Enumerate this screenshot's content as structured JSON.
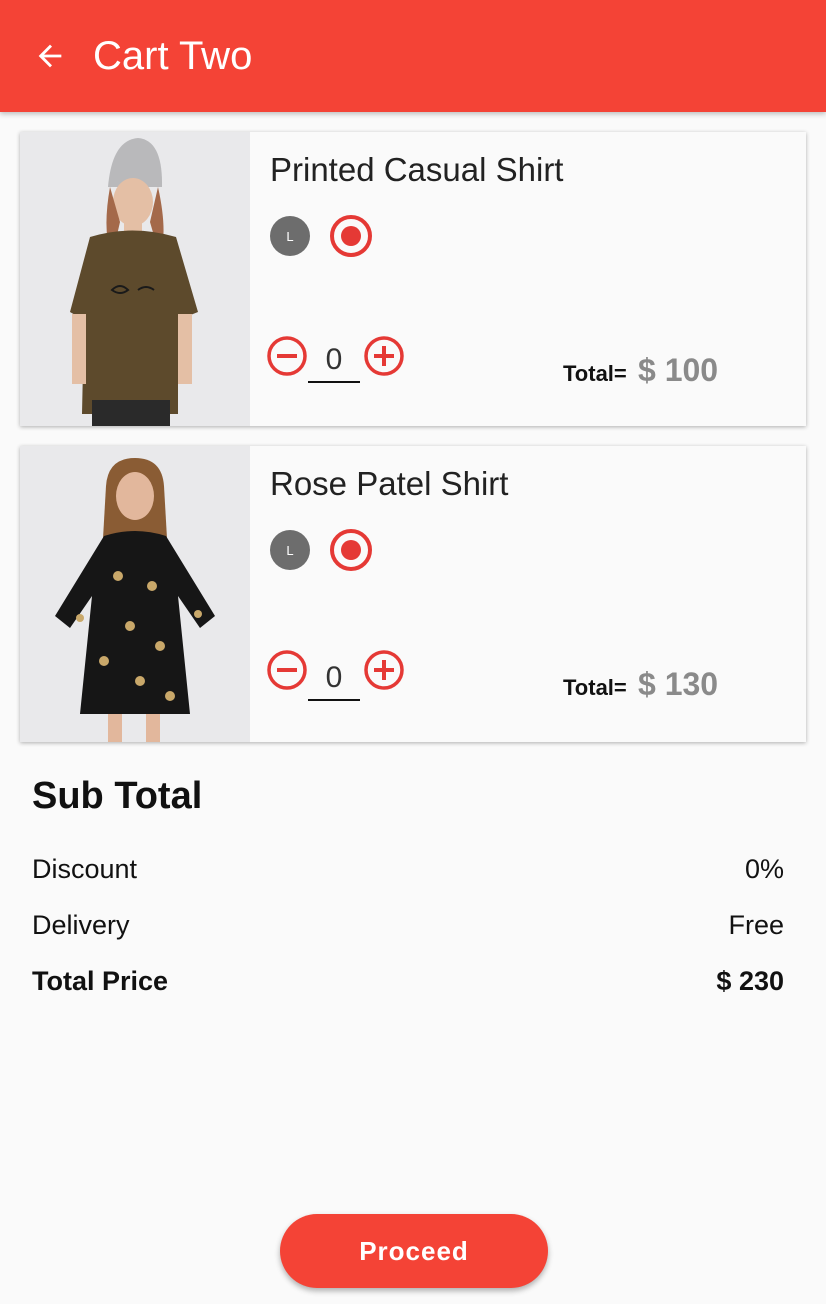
{
  "appbar": {
    "title": "Cart Two",
    "back_icon": "arrow-back-icon",
    "color": "#f44336"
  },
  "cart": {
    "items": [
      {
        "name": "Printed Casual Shirt",
        "size": "L",
        "quantity": "0",
        "total_label": "Total=",
        "total": "$ 100"
      },
      {
        "name": "Rose Patel Shirt",
        "size": "L",
        "quantity": "0",
        "total_label": "Total=",
        "total": "$ 130"
      }
    ],
    "icons": {
      "minus": "remove-circle-outline-icon",
      "plus": "add-circle-outline-icon",
      "radio": "radio-button-checked-icon"
    },
    "accent": "#e53935"
  },
  "summary": {
    "title": "Sub Total",
    "rows": [
      {
        "label": "Discount",
        "value": "0%"
      },
      {
        "label": "Delivery",
        "value": "Free"
      },
      {
        "label": "Total Price",
        "value": "$ 230"
      }
    ]
  },
  "proceed_label": "Proceed"
}
